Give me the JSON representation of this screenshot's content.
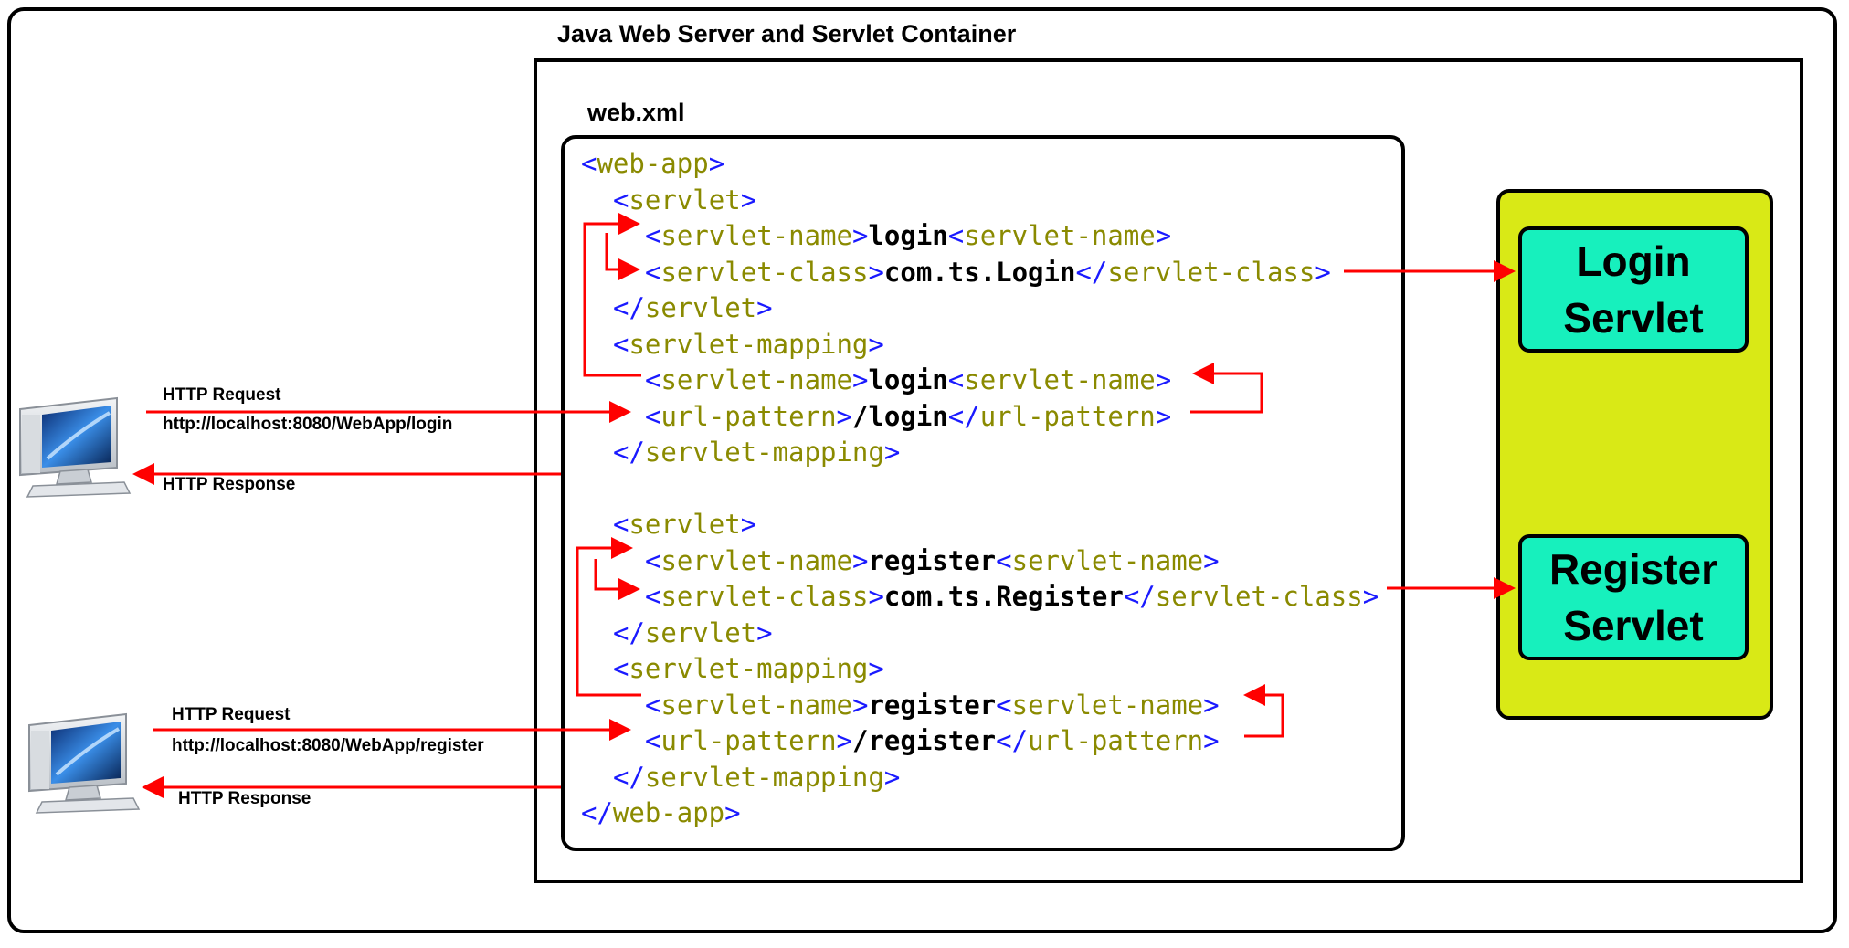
{
  "titles": {
    "container": "Java Web Server and Servlet Container",
    "webxml": "web.xml"
  },
  "code_lines": [
    {
      "indent": 0,
      "parts": [
        [
          "b",
          "<"
        ],
        [
          "t",
          "web-app"
        ],
        [
          "b",
          ">"
        ]
      ]
    },
    {
      "indent": 1,
      "parts": [
        [
          "b",
          "<"
        ],
        [
          "t",
          "servlet"
        ],
        [
          "b",
          ">"
        ]
      ]
    },
    {
      "indent": 2,
      "parts": [
        [
          "b",
          "<"
        ],
        [
          "t",
          "servlet-name"
        ],
        [
          "b",
          ">"
        ],
        [
          "v",
          "login"
        ],
        [
          "b",
          "<"
        ],
        [
          "t",
          "servlet-name"
        ],
        [
          "b",
          ">"
        ]
      ]
    },
    {
      "indent": 2,
      "parts": [
        [
          "b",
          "<"
        ],
        [
          "t",
          "servlet-class"
        ],
        [
          "b",
          ">"
        ],
        [
          "v",
          "com.ts.Login"
        ],
        [
          "b",
          "</"
        ],
        [
          "t",
          "servlet-class"
        ],
        [
          "b",
          ">"
        ]
      ]
    },
    {
      "indent": 1,
      "parts": [
        [
          "b",
          "</"
        ],
        [
          "t",
          "servlet"
        ],
        [
          "b",
          ">"
        ]
      ]
    },
    {
      "indent": 1,
      "parts": [
        [
          "b",
          "<"
        ],
        [
          "t",
          "servlet-mapping"
        ],
        [
          "b",
          ">"
        ]
      ]
    },
    {
      "indent": 2,
      "parts": [
        [
          "b",
          "<"
        ],
        [
          "t",
          "servlet-name"
        ],
        [
          "b",
          ">"
        ],
        [
          "v",
          "login"
        ],
        [
          "b",
          "<"
        ],
        [
          "t",
          "servlet-name"
        ],
        [
          "b",
          ">"
        ]
      ]
    },
    {
      "indent": 2,
      "parts": [
        [
          "b",
          "<"
        ],
        [
          "t",
          "url-pattern"
        ],
        [
          "b",
          ">"
        ],
        [
          "v",
          "/login"
        ],
        [
          "b",
          "</"
        ],
        [
          "t",
          "url-pattern"
        ],
        [
          "b",
          ">"
        ]
      ]
    },
    {
      "indent": 1,
      "parts": [
        [
          "b",
          "</"
        ],
        [
          "t",
          "servlet-mapping"
        ],
        [
          "b",
          ">"
        ]
      ]
    },
    {
      "indent": 0,
      "parts": []
    },
    {
      "indent": 1,
      "parts": [
        [
          "b",
          "<"
        ],
        [
          "t",
          "servlet"
        ],
        [
          "b",
          ">"
        ]
      ]
    },
    {
      "indent": 2,
      "parts": [
        [
          "b",
          "<"
        ],
        [
          "t",
          "servlet-name"
        ],
        [
          "b",
          ">"
        ],
        [
          "v",
          "register"
        ],
        [
          "b",
          "<"
        ],
        [
          "t",
          "servlet-name"
        ],
        [
          "b",
          ">"
        ]
      ]
    },
    {
      "indent": 2,
      "parts": [
        [
          "b",
          "<"
        ],
        [
          "t",
          "servlet-class"
        ],
        [
          "b",
          ">"
        ],
        [
          "v",
          "com.ts.Register"
        ],
        [
          "b",
          "</"
        ],
        [
          "t",
          "servlet-class"
        ],
        [
          "b",
          ">"
        ]
      ]
    },
    {
      "indent": 1,
      "parts": [
        [
          "b",
          "</"
        ],
        [
          "t",
          "servlet"
        ],
        [
          "b",
          ">"
        ]
      ]
    },
    {
      "indent": 1,
      "parts": [
        [
          "b",
          "<"
        ],
        [
          "t",
          "servlet-mapping"
        ],
        [
          "b",
          ">"
        ]
      ]
    },
    {
      "indent": 2,
      "parts": [
        [
          "b",
          "<"
        ],
        [
          "t",
          "servlet-name"
        ],
        [
          "b",
          ">"
        ],
        [
          "v",
          "register"
        ],
        [
          "b",
          "<"
        ],
        [
          "t",
          "servlet-name"
        ],
        [
          "b",
          ">"
        ]
      ]
    },
    {
      "indent": 2,
      "parts": [
        [
          "b",
          "<"
        ],
        [
          "t",
          "url-pattern"
        ],
        [
          "b",
          ">"
        ],
        [
          "v",
          "/register"
        ],
        [
          "b",
          "</"
        ],
        [
          "t",
          "url-pattern"
        ],
        [
          "b",
          ">"
        ]
      ]
    },
    {
      "indent": 1,
      "parts": [
        [
          "b",
          "</"
        ],
        [
          "t",
          "servlet-mapping"
        ],
        [
          "b",
          ">"
        ]
      ]
    },
    {
      "indent": 0,
      "parts": [
        [
          "b",
          "</"
        ],
        [
          "t",
          "web-app"
        ],
        [
          "b",
          ">"
        ]
      ]
    }
  ],
  "servlets": {
    "login": {
      "line1": "Login",
      "line2": "Servlet"
    },
    "register": {
      "line1": "Register",
      "line2": "Servlet"
    }
  },
  "clients": {
    "login": {
      "request_label": "HTTP Request",
      "url": "http://localhost:8080/WebApp/login",
      "response_label": "HTTP Response"
    },
    "register": {
      "request_label": "HTTP Request",
      "url": "http://localhost:8080/WebApp/register",
      "response_label": "HTTP Response"
    }
  },
  "colors": {
    "arrow": "#ff0000",
    "panel": "#d9e916",
    "servlet_box": "#17f0bd",
    "xml_bracket": "#1a1aff",
    "xml_tag": "#8a8a00"
  },
  "icons": [
    "computer-monitor-icon",
    "computer-monitor-icon"
  ]
}
